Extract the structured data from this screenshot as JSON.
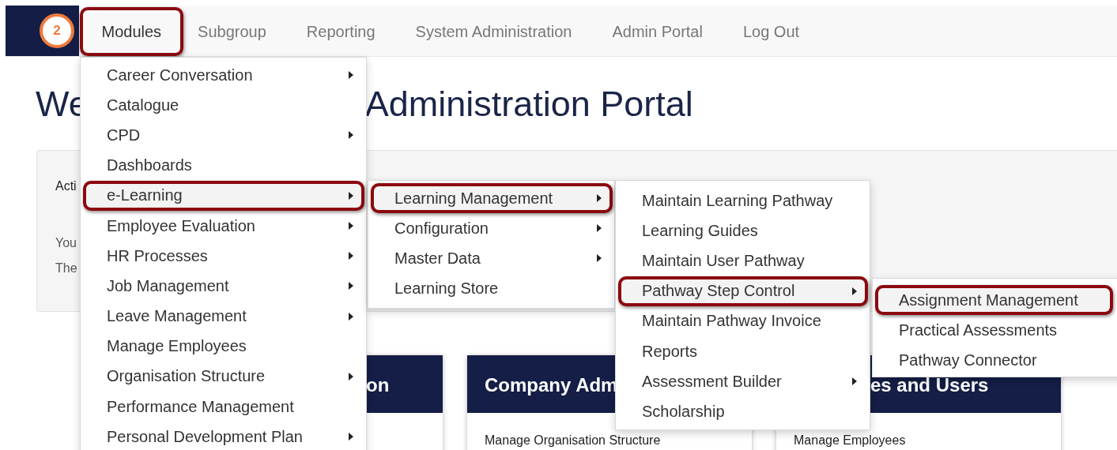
{
  "navbar": {
    "badge": "2",
    "items": [
      {
        "label": "Modules",
        "selected": true
      },
      {
        "label": "Subgroup",
        "selected": false
      },
      {
        "label": "Reporting",
        "selected": false
      },
      {
        "label": "System Administration",
        "selected": false
      },
      {
        "label": "Admin Portal",
        "selected": false
      },
      {
        "label": "Log Out",
        "selected": false
      }
    ]
  },
  "heading": {
    "parts": [
      "We",
      "Administration Portal"
    ]
  },
  "panel": {
    "lines": [
      "Acti",
      "You",
      "The"
    ]
  },
  "cards": [
    {
      "title": "on"
    },
    {
      "title": "Company Adm",
      "links": [
        "Manage Organisation Structure"
      ]
    },
    {
      "title": "es and Users",
      "links": [
        "Manage Employees"
      ]
    }
  ],
  "menus": [
    {
      "items": [
        {
          "label": "Career Conversation",
          "has_submenu": true,
          "selected": false
        },
        {
          "label": "Catalogue",
          "has_submenu": false,
          "selected": false
        },
        {
          "label": "CPD",
          "has_submenu": true,
          "selected": false
        },
        {
          "label": "Dashboards",
          "has_submenu": false,
          "selected": false
        },
        {
          "label": "e-Learning",
          "has_submenu": true,
          "selected": true
        },
        {
          "label": "Employee Evaluation",
          "has_submenu": true,
          "selected": false
        },
        {
          "label": "HR Processes",
          "has_submenu": true,
          "selected": false
        },
        {
          "label": "Job Management",
          "has_submenu": true,
          "selected": false
        },
        {
          "label": "Leave Management",
          "has_submenu": true,
          "selected": false
        },
        {
          "label": "Manage Employees",
          "has_submenu": false,
          "selected": false
        },
        {
          "label": "Organisation Structure",
          "has_submenu": true,
          "selected": false
        },
        {
          "label": "Performance Management",
          "has_submenu": false,
          "selected": false
        },
        {
          "label": "Personal Development Plan",
          "has_submenu": true,
          "selected": false
        }
      ]
    },
    {
      "items": [
        {
          "label": "Learning Management",
          "has_submenu": true,
          "selected": true
        },
        {
          "label": "Configuration",
          "has_submenu": true,
          "selected": false
        },
        {
          "label": "Master Data",
          "has_submenu": true,
          "selected": false
        },
        {
          "label": "Learning Store",
          "has_submenu": false,
          "selected": false
        }
      ]
    },
    {
      "items": [
        {
          "label": "Maintain Learning Pathway",
          "has_submenu": false,
          "selected": false
        },
        {
          "label": "Learning Guides",
          "has_submenu": false,
          "selected": false
        },
        {
          "label": "Maintain User Pathway",
          "has_submenu": false,
          "selected": false
        },
        {
          "label": "Pathway Step Control",
          "has_submenu": true,
          "selected": true
        },
        {
          "label": "Maintain Pathway Invoice",
          "has_submenu": false,
          "selected": false
        },
        {
          "label": "Reports",
          "has_submenu": false,
          "selected": false
        },
        {
          "label": "Assessment Builder",
          "has_submenu": true,
          "selected": false
        },
        {
          "label": "Scholarship",
          "has_submenu": false,
          "selected": false
        }
      ]
    },
    {
      "items": [
        {
          "label": "Assignment Management",
          "has_submenu": false,
          "selected": true
        },
        {
          "label": "Practical Assessments",
          "has_submenu": false,
          "selected": false
        },
        {
          "label": "Pathway Connector",
          "has_submenu": false,
          "selected": false
        }
      ]
    }
  ]
}
